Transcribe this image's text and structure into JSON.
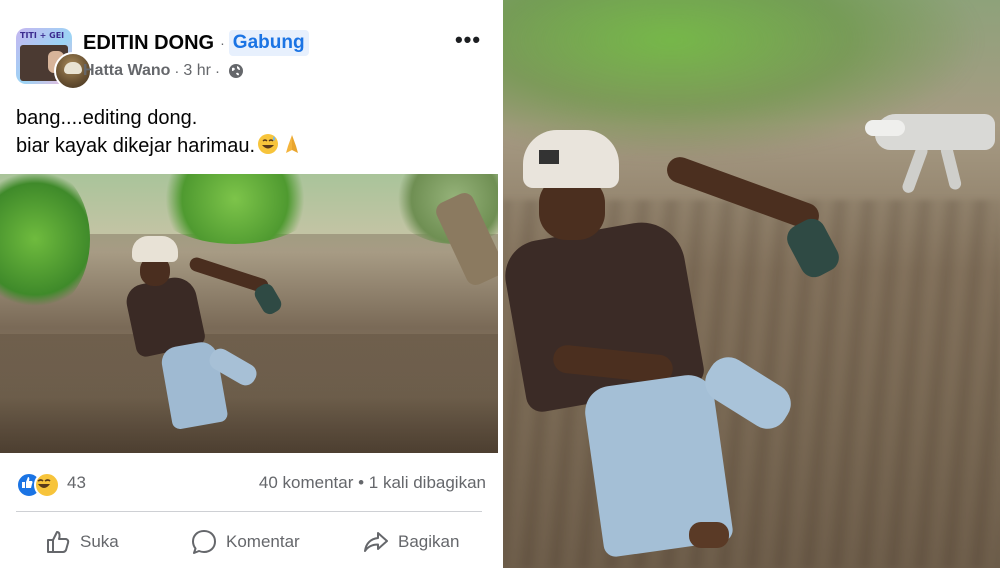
{
  "post": {
    "group_name": "EDITIN DONG",
    "separator": "·",
    "join_label": "Gabung",
    "author": "Hatta Wano",
    "meta_separator": "·",
    "time": "3 hr",
    "meta_separator2": "·",
    "avatar_text": "TITI + GEI",
    "more_label": "•••",
    "text_line1": "bang....editing dong.",
    "text_line2": "biar kayak dikejar harimau.",
    "text_emojis": [
      "grinning-sweat-emoji",
      "folded-hands-emoji"
    ]
  },
  "stats": {
    "reaction_count": "43",
    "comments": "40 komentar",
    "stats_separator": "•",
    "shares": "1 kali dibagikan"
  },
  "actions": {
    "like": "Suka",
    "comment": "Komentar",
    "share": "Bagikan"
  },
  "colors": {
    "link_blue": "#1b74e4",
    "secondary_text": "#65676b",
    "primary_text": "#050505"
  }
}
